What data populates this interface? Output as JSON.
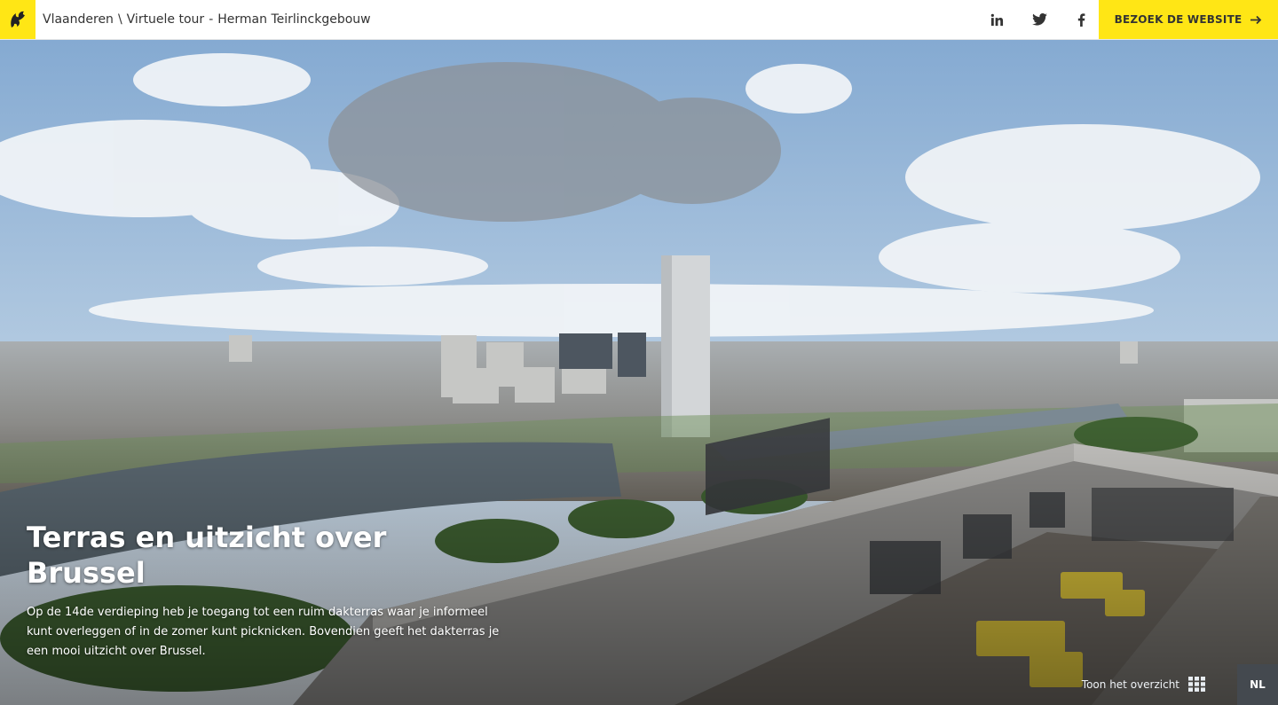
{
  "header": {
    "breadcrumb": [
      "Vlaanderen",
      "\\",
      "Virtuele tour",
      "-",
      "Herman Teirlinckgebouw"
    ],
    "social": [
      "linkedin-icon",
      "twitter-icon",
      "facebook-icon"
    ],
    "visit_label": "BEZOEK DE WEBSITE"
  },
  "hero": {
    "title": "Terras en uitzicht over Brussel",
    "description": "Op de 14de verdieping heb je toegang tot een ruim dakterras waar je informeel kunt overleggen of in de zomer kunt picknicken. Bovendien geeft het dakterras je een mooi uitzicht over Brussel."
  },
  "footer": {
    "overview_label": "Toon het overzicht",
    "language": "NL"
  },
  "colors": {
    "accent": "#ffe615",
    "sky": "#8fb3d8",
    "water": "#5a6770"
  }
}
